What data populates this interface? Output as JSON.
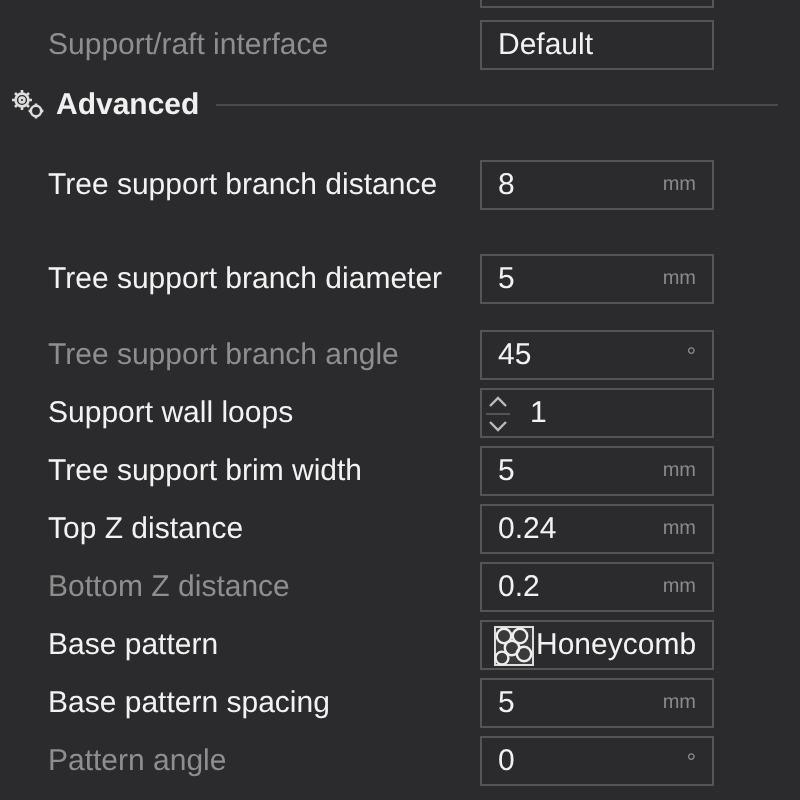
{
  "rows_before": [
    {
      "label": "Support/raft interface",
      "dimmed": true,
      "kind": "text",
      "value": "Default"
    }
  ],
  "section": {
    "title": "Advanced"
  },
  "rows": [
    {
      "label": "Tree support branch distance",
      "dimmed": false,
      "kind": "number",
      "value": "8",
      "unit": "mm"
    },
    {
      "label": "Tree support branch diameter",
      "dimmed": false,
      "kind": "number",
      "value": "5",
      "unit": "mm"
    },
    {
      "label": "Tree support branch angle",
      "dimmed": true,
      "kind": "number",
      "value": "45",
      "unit": "°"
    },
    {
      "label": "Support wall loops",
      "dimmed": false,
      "kind": "spin",
      "value": "1"
    },
    {
      "label": "Tree support brim width",
      "dimmed": false,
      "kind": "number",
      "value": "5",
      "unit": "mm"
    },
    {
      "label": "Top Z distance",
      "dimmed": false,
      "kind": "number",
      "value": "0.24",
      "unit": "mm"
    },
    {
      "label": "Bottom Z distance",
      "dimmed": true,
      "kind": "number",
      "value": "0.2",
      "unit": "mm"
    },
    {
      "label": "Base pattern",
      "dimmed": false,
      "kind": "combo",
      "value": "Honeycomb"
    },
    {
      "label": "Base pattern spacing",
      "dimmed": false,
      "kind": "number",
      "value": "5",
      "unit": "mm"
    },
    {
      "label": "Pattern angle",
      "dimmed": true,
      "kind": "number",
      "value": "0",
      "unit": "°"
    }
  ]
}
